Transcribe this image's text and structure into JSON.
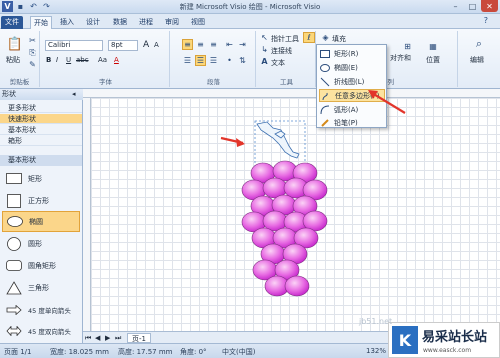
{
  "window": {
    "title": "新建 Microsoft Visio 绘图 - Microsoft Visio"
  },
  "tabs": [
    "文件",
    "开始",
    "插入",
    "设计",
    "数据",
    "进程",
    "审阅",
    "视图"
  ],
  "ribbon": {
    "clipboard": {
      "paste": "粘贴",
      "group": "剪贴板"
    },
    "font": {
      "name": "Calibri",
      "size": "8pt",
      "group": "字体",
      "increase": "A",
      "decrease": "A",
      "bold": "B",
      "italic": "I",
      "underline": "U",
      "strikethrough": "abc",
      "case": "Aa",
      "color": "A"
    },
    "paragraph": {
      "group": "段落"
    },
    "tools": {
      "pointer": "指针工具",
      "connector": "连接线",
      "text": "文本",
      "group": "工具"
    },
    "shape": {
      "fill": "填充",
      "group": "排列",
      "align": "对齐和",
      "position_btn": "位置",
      "edit": "编辑"
    }
  },
  "drawing_tools_menu": {
    "items": [
      {
        "label": "矩形(R)",
        "icon": "rectangle-icon"
      },
      {
        "label": "椭圆(E)",
        "icon": "ellipse-icon"
      },
      {
        "label": "折线图(L)",
        "icon": "line-icon"
      },
      {
        "label": "任意多边形(F)",
        "icon": "freeform-icon",
        "selected": true
      },
      {
        "label": "弧形(A)",
        "icon": "arc-icon"
      },
      {
        "label": "铅笔(P)",
        "icon": "pencil-icon"
      }
    ]
  },
  "shapes_panel": {
    "title": "形状",
    "categories": [
      {
        "label": "更多形状",
        "selected": false
      },
      {
        "label": "快速形状",
        "selected": true
      },
      {
        "label": "基本形状",
        "selected": false
      },
      {
        "label": "箱形",
        "selected": false
      }
    ],
    "stencil_title": "基本形状",
    "stencil_items": [
      {
        "label": "矩形",
        "selected": false
      },
      {
        "label": "正方形",
        "selected": false
      },
      {
        "label": "椭圆",
        "selected": true
      },
      {
        "label": "圆形",
        "selected": false
      },
      {
        "label": "圆角矩形",
        "selected": false
      },
      {
        "label": "三角形",
        "selected": false
      },
      {
        "label": "45 度单向箭头",
        "selected": false
      },
      {
        "label": "45 度双向箭头",
        "selected": false
      }
    ]
  },
  "page_tabs": {
    "current": "页-1"
  },
  "status": {
    "page": "页面 1/1",
    "width": "宽度: 18.025 mm",
    "height": "高度: 17.57 mm",
    "angle": "角度: 0°",
    "language": "中文(中国)",
    "zoom": "132%"
  },
  "watermark": {
    "text": "易采站长站",
    "sub": "www.easck.com",
    "url": "jb51.net"
  },
  "colors": {
    "accent": "#2b5797",
    "grape_light": "#f7b6f0",
    "grape_dark": "#c21fc9",
    "arrow": "#e2352b"
  }
}
